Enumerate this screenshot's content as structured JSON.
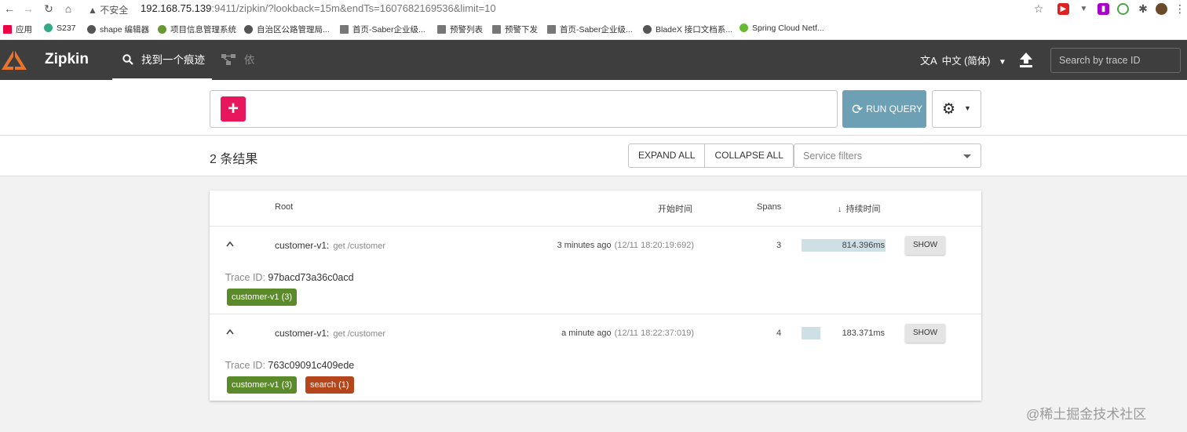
{
  "browser": {
    "insecure_label": "不安全",
    "url_host": "192.168.75.139",
    "url_rest": ":9411/zipkin/?lookback=15m&endTs=1607682169536&limit=10",
    "bookmarks": [
      "应用",
      "S237",
      "shape 编辑器",
      "项目信息管理系统",
      "自治区公路管理局...",
      "首页-Saber企业级...",
      "预警列表",
      "预警下发",
      "首页-Saber企业级...",
      "BladeX 接口文档系...",
      "Spring Cloud Netf..."
    ]
  },
  "header": {
    "brand": "Zipkin",
    "tab_find": "找到一个痕迹",
    "tab_deps": "依赖",
    "language": "中文 (简体)",
    "search_placeholder": "Search by trace ID"
  },
  "query": {
    "run_label": "RUN QUERY"
  },
  "results": {
    "count_label": "2 条结果",
    "expand_all": "EXPAND ALL",
    "collapse_all": "COLLAPSE ALL",
    "service_filters_placeholder": "Service filters"
  },
  "table": {
    "col_root": "Root",
    "col_start": "开始时间",
    "col_spans": "Spans",
    "col_duration": "持续时间",
    "rows": [
      {
        "service": "customer-v1:",
        "operation": "get /customer",
        "ago": "3 minutes ago",
        "timestamp": "(12/11 18:20:19:692)",
        "spans": "3",
        "duration": "814.396ms",
        "duration_fraction": 1.0,
        "show_label": "SHOW",
        "trace_id_label": "Trace ID:",
        "trace_id": "97bacd73a36c0acd",
        "badges": [
          {
            "label": "customer-v1 (3)",
            "color": "#5b8a2a"
          }
        ]
      },
      {
        "service": "customer-v1:",
        "operation": "get /customer",
        "ago": "a minute ago",
        "timestamp": "(12/11 18:22:37:019)",
        "spans": "4",
        "duration": "183.371ms",
        "duration_fraction": 0.225,
        "show_label": "SHOW",
        "trace_id_label": "Trace ID:",
        "trace_id": "763c09091c409ede",
        "badges": [
          {
            "label": "customer-v1 (3)",
            "color": "#5b8a2a"
          },
          {
            "label": "search (1)",
            "color": "#b5451b"
          }
        ]
      }
    ]
  },
  "watermark": "@稀土掘金技术社区",
  "colors": {
    "accent_pink": "#e8175d",
    "run_query": "#6ea0b5",
    "header_bg": "#3e3e3e",
    "duration_bar": "#cfdfe6"
  }
}
